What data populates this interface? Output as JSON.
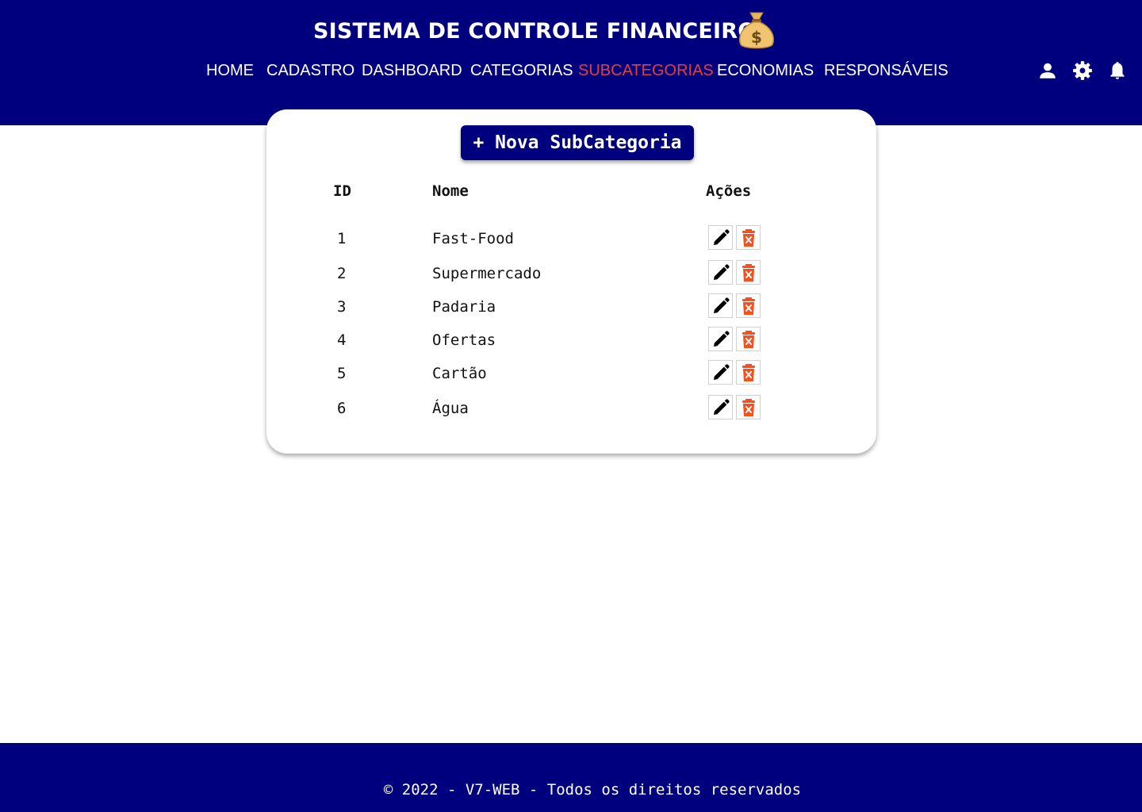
{
  "header": {
    "title": "SISTEMA DE CONTROLE FINANCEIRO",
    "logo_icon": "money-bag-icon"
  },
  "nav": {
    "items": [
      {
        "label": "HOME",
        "active": false
      },
      {
        "label": "CADASTRO",
        "active": false
      },
      {
        "label": "DASHBOARD",
        "active": false
      },
      {
        "label": "CATEGORIAS",
        "active": false
      },
      {
        "label": "SUBCATEGORIAS",
        "active": true
      },
      {
        "label": "ECONOMIAS",
        "active": false
      },
      {
        "label": "RESPONSÁVEIS",
        "active": false
      }
    ],
    "active_color": "#e0403c"
  },
  "header_icons": [
    "user-icon",
    "gear-icon",
    "bell-icon"
  ],
  "card": {
    "new_button_label": "+ Nova SubCategoria",
    "columns": {
      "id": "ID",
      "name": "Nome",
      "actions": "Ações"
    },
    "rows": [
      {
        "id": "1",
        "name": "Fast-Food"
      },
      {
        "id": "2",
        "name": "Supermercado"
      },
      {
        "id": "3",
        "name": "Padaria"
      },
      {
        "id": "4",
        "name": "Ofertas"
      },
      {
        "id": "5",
        "name": "Cartão"
      },
      {
        "id": "6",
        "name": "Água"
      }
    ],
    "action_icons": [
      "pencil-icon",
      "trash-icon"
    ]
  },
  "footer": {
    "text": "© 2022 - V7-WEB - Todos os direitos reservados"
  },
  "colors": {
    "primary": "#00007f",
    "delete": "#f4511e",
    "background": "#ffffff"
  }
}
